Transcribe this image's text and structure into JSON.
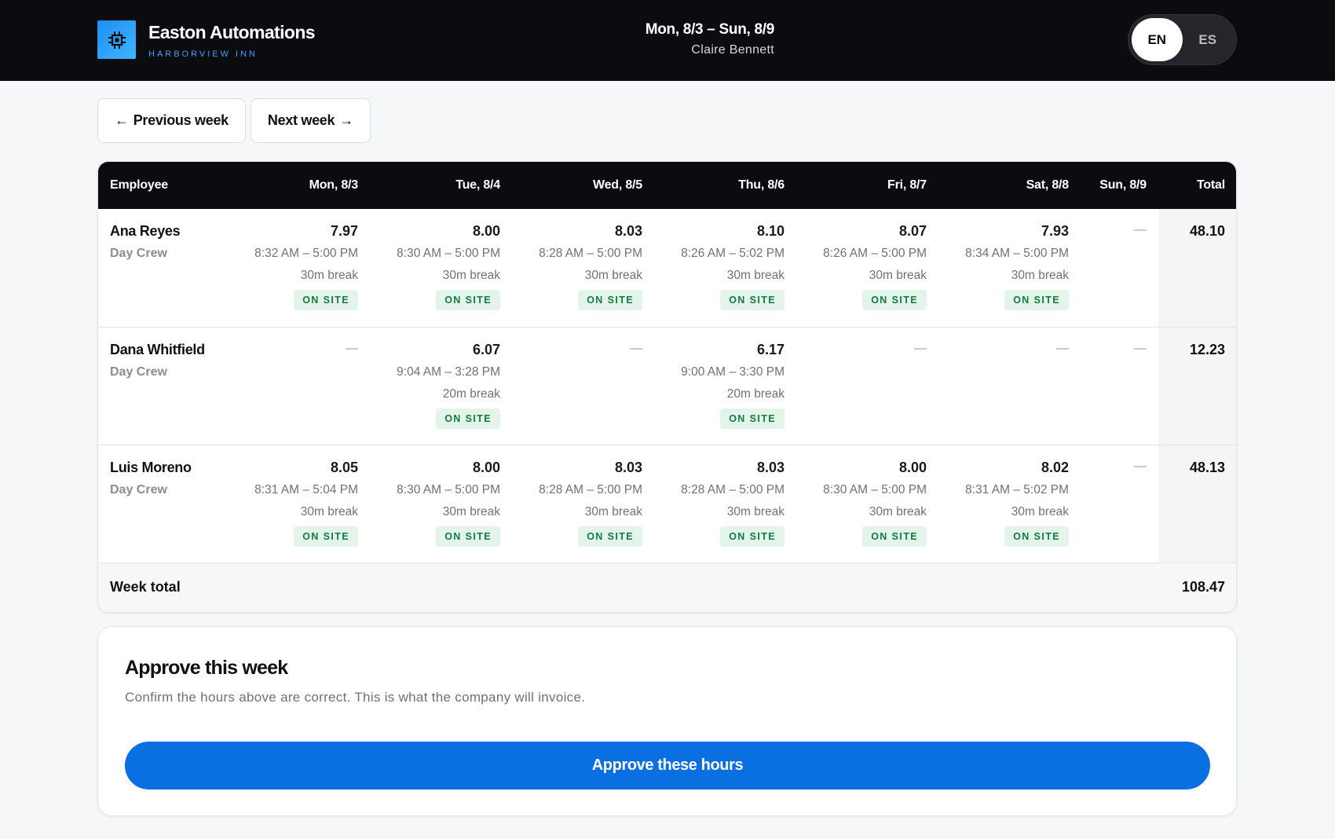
{
  "header": {
    "company": "Easton Automations",
    "site": "HARBORVIEW INN",
    "week_range": "Mon, 8/3 – Sun, 8/9",
    "person": "Claire Bennett",
    "lang_en": "EN",
    "lang_es": "ES"
  },
  "nav": {
    "prev_label": "Previous week",
    "next_label": "Next week"
  },
  "table": {
    "col_employee": "Employee",
    "days": [
      "Mon, 8/3",
      "Tue, 8/4",
      "Wed, 8/5",
      "Thu, 8/6",
      "Fri, 8/7",
      "Sat, 8/8",
      "Sun, 8/9"
    ],
    "col_total": "Total",
    "rows": [
      {
        "name": "Ana Reyes",
        "role": "Day Crew",
        "total": "48.10",
        "days": [
          {
            "hours": "7.97",
            "times": "8:32 AM – 5:00 PM",
            "break": "30m break",
            "status": "ON SITE"
          },
          {
            "hours": "8.00",
            "times": "8:30 AM – 5:00 PM",
            "break": "30m break",
            "status": "ON SITE"
          },
          {
            "hours": "8.03",
            "times": "8:28 AM – 5:00 PM",
            "break": "30m break",
            "status": "ON SITE"
          },
          {
            "hours": "8.10",
            "times": "8:26 AM – 5:02 PM",
            "break": "30m break",
            "status": "ON SITE"
          },
          {
            "hours": "8.07",
            "times": "8:26 AM – 5:00 PM",
            "break": "30m break",
            "status": "ON SITE"
          },
          {
            "hours": "7.93",
            "times": "8:34 AM – 5:00 PM",
            "break": "30m break",
            "status": "ON SITE"
          },
          null
        ]
      },
      {
        "name": "Dana Whitfield",
        "role": "Day Crew",
        "total": "12.23",
        "days": [
          null,
          {
            "hours": "6.07",
            "times": "9:04 AM – 3:28 PM",
            "break": "20m break",
            "status": "ON SITE"
          },
          null,
          {
            "hours": "6.17",
            "times": "9:00 AM – 3:30 PM",
            "break": "20m break",
            "status": "ON SITE"
          },
          null,
          null,
          null
        ]
      },
      {
        "name": "Luis Moreno",
        "role": "Day Crew",
        "total": "48.13",
        "days": [
          {
            "hours": "8.05",
            "times": "8:31 AM – 5:04 PM",
            "break": "30m break",
            "status": "ON SITE"
          },
          {
            "hours": "8.00",
            "times": "8:30 AM – 5:00 PM",
            "break": "30m break",
            "status": "ON SITE"
          },
          {
            "hours": "8.03",
            "times": "8:28 AM – 5:00 PM",
            "break": "30m break",
            "status": "ON SITE"
          },
          {
            "hours": "8.03",
            "times": "8:28 AM – 5:00 PM",
            "break": "30m break",
            "status": "ON SITE"
          },
          {
            "hours": "8.00",
            "times": "8:30 AM – 5:00 PM",
            "break": "30m break",
            "status": "ON SITE"
          },
          {
            "hours": "8.02",
            "times": "8:31 AM – 5:02 PM",
            "break": "30m break",
            "status": "ON SITE"
          },
          null
        ]
      }
    ],
    "empty_mark": "—",
    "week_total_label": "Week total",
    "week_total": "108.47"
  },
  "approve": {
    "title": "Approve this week",
    "description": "Confirm the hours above are correct. This is what the company will invoice.",
    "button_label": "Approve these hours"
  },
  "colors": {
    "header_bg": "#0b0c0f",
    "accent_blue": "#0a6fe0",
    "badge_bg": "#e3f4ea",
    "badge_text": "#157a3f"
  }
}
